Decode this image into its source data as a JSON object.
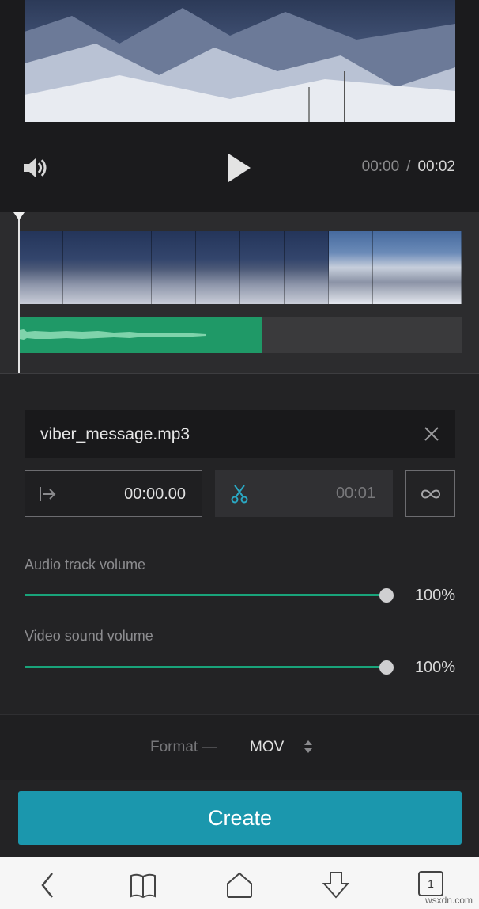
{
  "player": {
    "current_time": "00:00",
    "separator": "/",
    "total_time": "00:02",
    "volume_icon": "speaker-icon",
    "play_icon": "play-icon"
  },
  "timeline": {
    "video_thumbnail_count": 10,
    "audio_clip_label": "",
    "colors": {
      "audio_clip": "#1f9967",
      "playhead": "#e4e4e4"
    }
  },
  "audio": {
    "file_name": "viber_message.mp3",
    "remove_icon": "close-icon",
    "start_icon": "start-position-icon",
    "start_time": "00:00.00",
    "trim_icon": "scissors-icon",
    "end_time": "00:01",
    "loop_icon": "infinity-icon"
  },
  "volumes": {
    "audio_track": {
      "label": "Audio track volume",
      "value": "100%",
      "level": 1.0
    },
    "video_sound": {
      "label": "Video sound volume",
      "value": "100%",
      "level": 1.0
    }
  },
  "format": {
    "label": "Format —",
    "value": "MOV",
    "arrows_icon": "up-down-arrows-icon"
  },
  "actions": {
    "create_label": "Create",
    "colors": {
      "create_button": "#1b97ad",
      "slider_accent": "#19a37a"
    }
  },
  "browser": {
    "back_icon": "back-arrow-icon",
    "bookmarks_icon": "book-icon",
    "home_icon": "home-icon",
    "download_icon": "download-icon",
    "tabs_count": "1"
  },
  "watermark": "wsxdn.com"
}
